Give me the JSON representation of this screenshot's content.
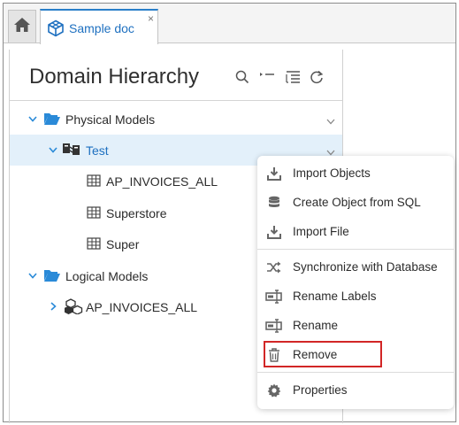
{
  "tabs": {
    "home_icon": "home-icon",
    "document_tab": {
      "label": "Sample doc",
      "icon": "cube-icon",
      "close": "×"
    }
  },
  "panel": {
    "title": "Domain Hierarchy",
    "header_icons": [
      "search-icon",
      "collapse-list-icon",
      "sort-list-icon",
      "refresh-icon"
    ]
  },
  "tree": {
    "physical_models": {
      "label": "Physical Models",
      "icon": "folder-open-icon",
      "expanded": true
    },
    "test": {
      "label": "Test",
      "icon": "database-connection-icon",
      "expanded": true,
      "selected": true
    },
    "tables": [
      {
        "label": "AP_INVOICES_ALL",
        "icon": "table-icon"
      },
      {
        "label": "Superstore",
        "icon": "table-icon"
      },
      {
        "label": "Super",
        "icon": "table-icon"
      }
    ],
    "logical_models": {
      "label": "Logical Models",
      "icon": "folder-open-icon",
      "expanded": true
    },
    "logical_child": {
      "label": "AP_INVOICES_ALL",
      "icon": "cubes-icon",
      "expanded": false
    }
  },
  "context_menu": {
    "items": [
      {
        "label": "Import Objects",
        "icon": "download-icon"
      },
      {
        "label": "Create Object from SQL",
        "icon": "database-icon"
      },
      {
        "label": "Import File",
        "icon": "download-icon"
      },
      {
        "label": "Synchronize with Database",
        "icon": "shuffle-icon"
      },
      {
        "label": "Rename Labels",
        "icon": "rename-icon"
      },
      {
        "label": "Rename",
        "icon": "rename-icon"
      },
      {
        "label": "Remove",
        "icon": "trash-icon"
      },
      {
        "label": "Properties",
        "icon": "gear-icon"
      }
    ],
    "highlighted_item": "Remove",
    "highlight_color": "#d22626"
  },
  "colors": {
    "accent": "#1e70c0",
    "selected_row": "#e3f0fa",
    "folder": "#2a8ad8"
  }
}
